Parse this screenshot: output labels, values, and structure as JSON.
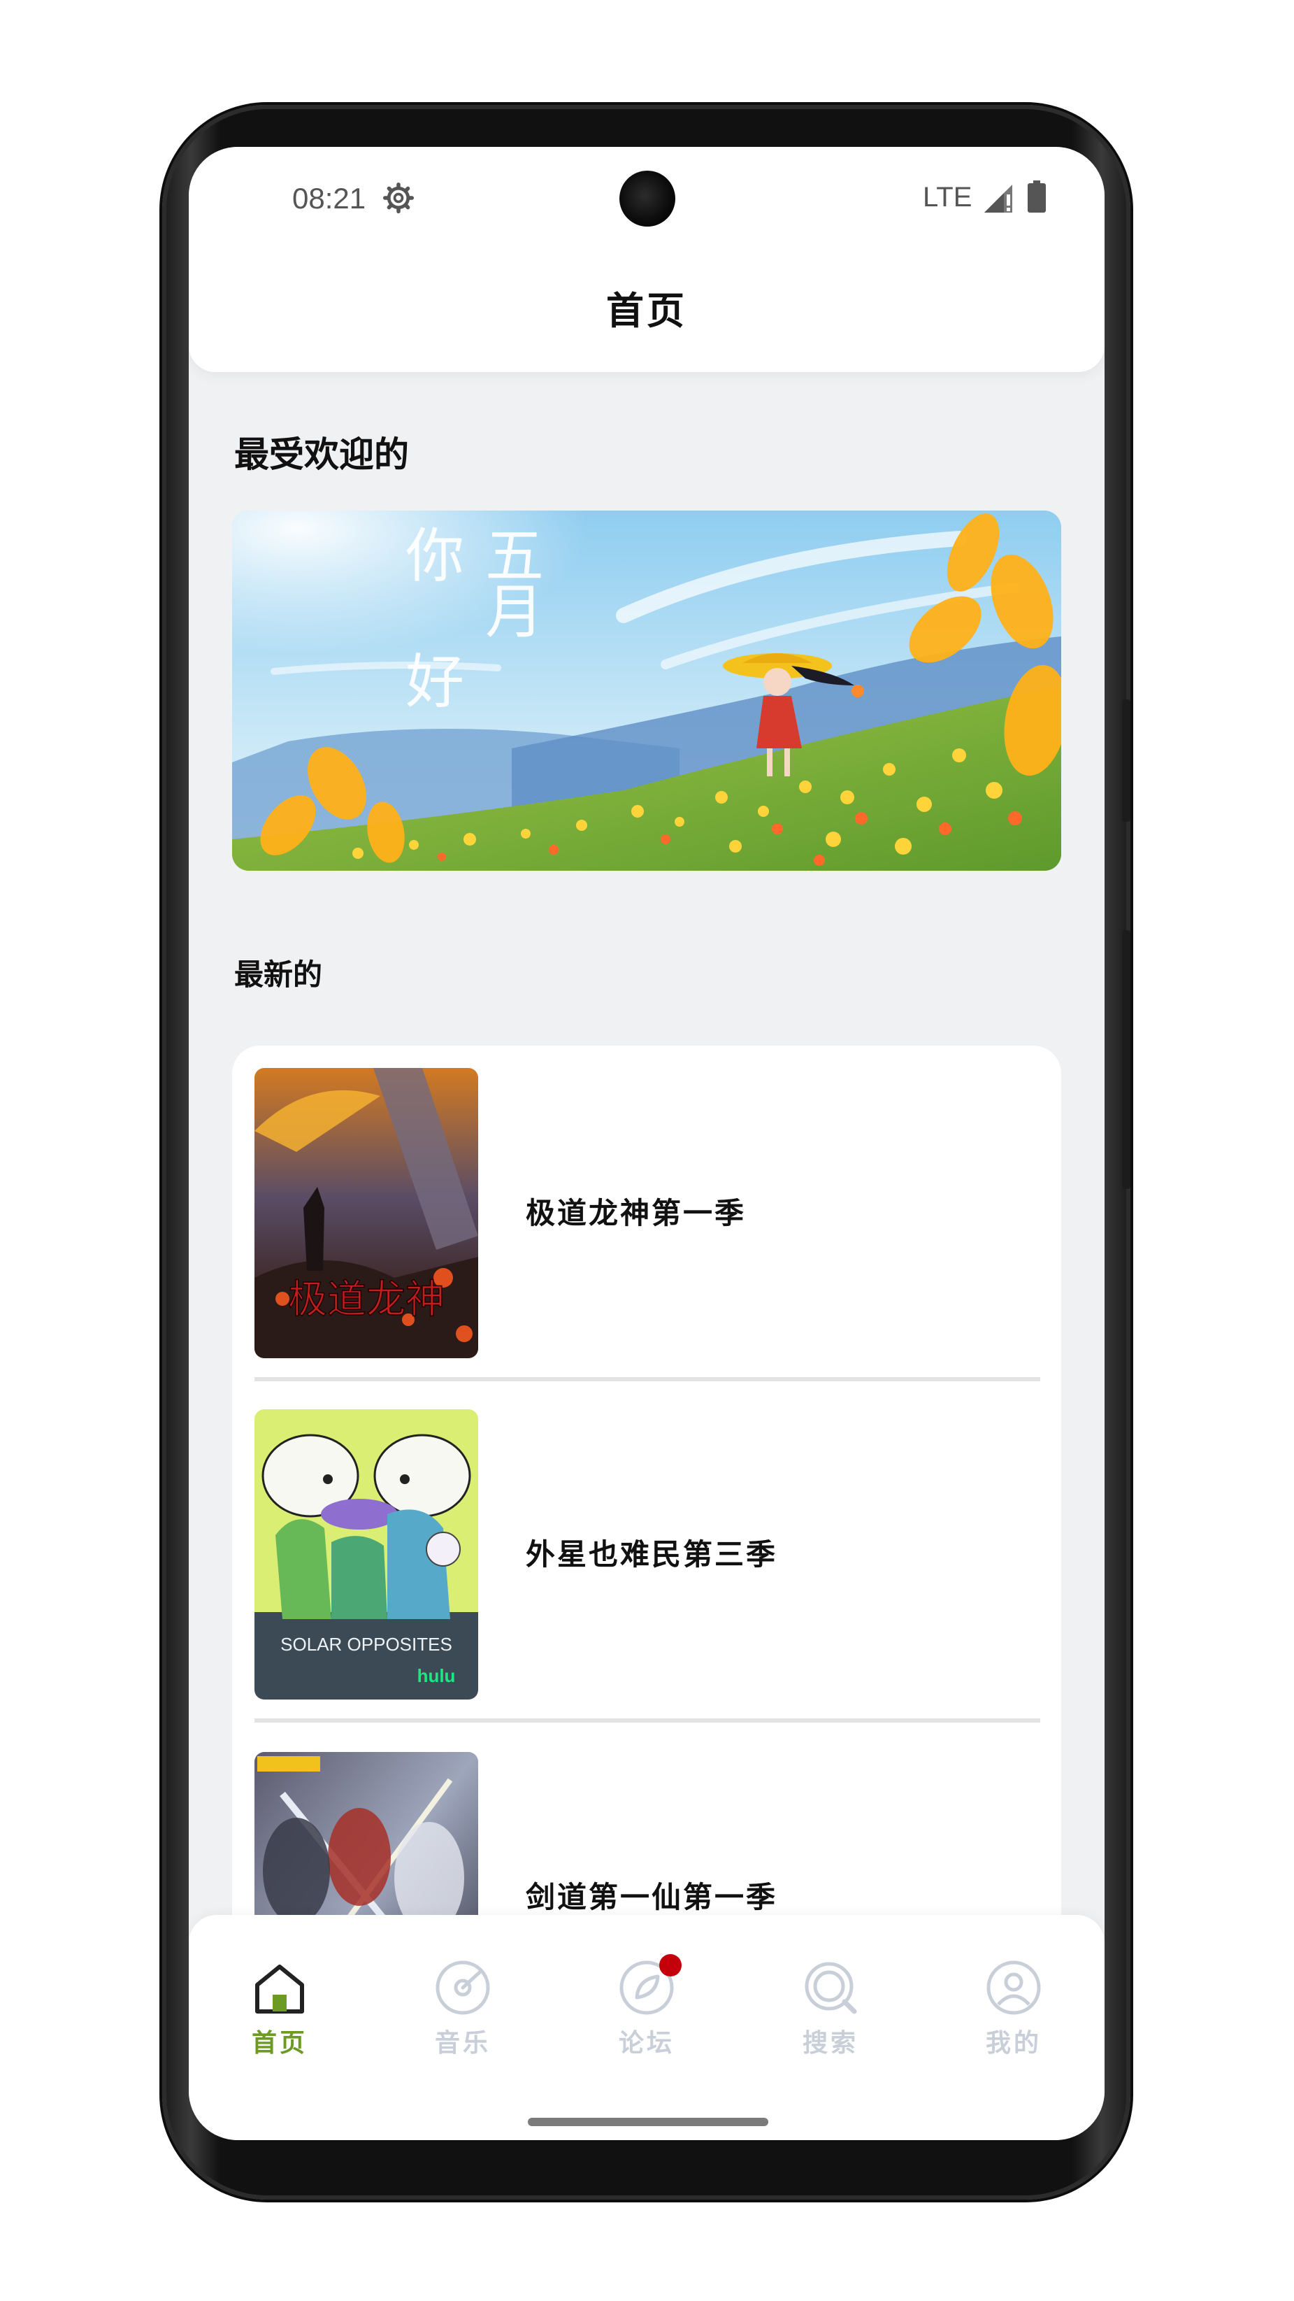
{
  "status_bar": {
    "time": "08:21",
    "network": "LTE",
    "icons": [
      "settings-gear-icon",
      "signal-icon",
      "battery-icon"
    ]
  },
  "app_bar": {
    "title": "首页"
  },
  "popular": {
    "section_title": "最受欢迎的",
    "banner": {
      "headline_chars": [
        "你",
        "好",
        "五",
        "月"
      ]
    }
  },
  "latest": {
    "section_title": "最新的",
    "items": [
      {
        "title": "极道龙神第一季"
      },
      {
        "title": "外星也难民第三季"
      },
      {
        "title": "剑道第一仙第一季"
      }
    ]
  },
  "bottom_nav": {
    "items": [
      {
        "label": "首页",
        "icon": "home-icon",
        "active": true
      },
      {
        "label": "音乐",
        "icon": "music-disc-icon",
        "active": false
      },
      {
        "label": "论坛",
        "icon": "forum-leaf-icon",
        "active": false,
        "badge": true
      },
      {
        "label": "搜索",
        "icon": "search-icon",
        "active": false
      },
      {
        "label": "我的",
        "icon": "profile-icon",
        "active": false
      }
    ]
  },
  "colors": {
    "accent_green": "#6c9a23",
    "inactive_gray": "#c9cfd8",
    "badge_red": "#c4000a",
    "background": "#f0f1f3"
  }
}
